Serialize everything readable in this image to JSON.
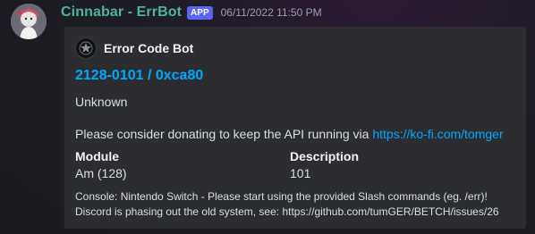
{
  "message": {
    "username": "Cinnabar - ErrBot",
    "app_tag": "APP",
    "timestamp": "06/11/2022 11:50 PM",
    "avatar_icon": "anime-character-avatar"
  },
  "embed": {
    "author_icon": "bot-avatar-icon",
    "author_name": "Error Code Bot",
    "title": "2128-0101 / 0xca80",
    "description": "Unknown",
    "donate_text": "Please consider donating to keep the API running via ",
    "donate_link": "https://ko-fi.com/tomger",
    "fields": [
      {
        "name": "Module",
        "value": "Am (128)"
      },
      {
        "name": "Description",
        "value": "101"
      }
    ],
    "footer_line1": "Console: Nintendo Switch - Please start using the provided Slash commands (eg. /err)!",
    "footer_line2": "Discord is phasing out the old system, see: https://github.com/tumGER/BETCH/issues/26"
  },
  "colors": {
    "username": "#4fb39a",
    "app_tag_bg": "#5865f2",
    "link": "#00a8fc",
    "embed_bg": "#2b2d31"
  }
}
